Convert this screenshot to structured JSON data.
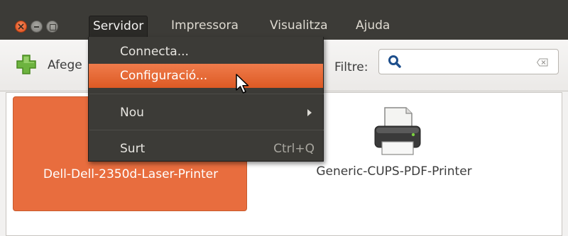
{
  "window": {
    "controls": [
      "close-icon",
      "minimize-icon",
      "maximize-icon"
    ]
  },
  "menubar": {
    "items": [
      "Servidor",
      "Impressora",
      "Visualitza",
      "Ajuda"
    ]
  },
  "toolbar": {
    "add_label": "Afege",
    "filter_label": "Filtre:",
    "search": {
      "value": "",
      "placeholder": ""
    }
  },
  "dropdown": {
    "items": [
      {
        "label": "Connecta...",
        "highlighted": false
      },
      {
        "label": "Configuració...",
        "highlighted": true
      },
      {
        "label": "Nou",
        "submenu": true
      },
      {
        "label": "Surt",
        "shortcut": "Ctrl+Q"
      }
    ]
  },
  "printers": [
    {
      "name": "Dell-Dell-2350d-Laser-Printer",
      "selected": true
    },
    {
      "name": "Generic-CUPS-PDF-Printer",
      "selected": false
    }
  ],
  "colors": {
    "accent": "#e86d3e",
    "menubar": "#3c3b37",
    "highlight": "#ef7b4b"
  }
}
